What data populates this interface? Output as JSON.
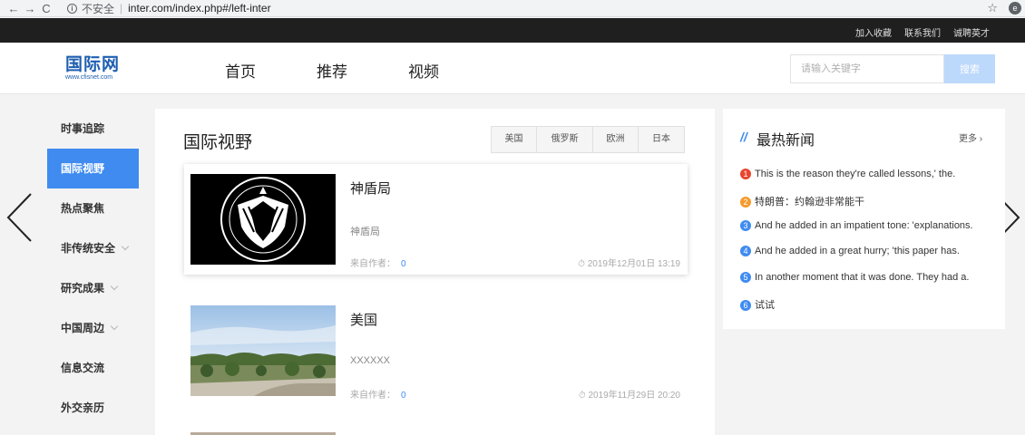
{
  "browser": {
    "back": "←",
    "forward": "→",
    "reload": "C",
    "security_label": "不安全",
    "url": "inter.com/index.php#/left-inter"
  },
  "topbar": {
    "links": [
      "加入收藏",
      "联系我们",
      "诚聘英才"
    ]
  },
  "header": {
    "logo_text": "国际网",
    "logo_sub": "www.cfisnet.com",
    "nav": [
      "首页",
      "推荐",
      "视频"
    ],
    "search_placeholder": "请输入关键字",
    "search_button": "搜索"
  },
  "sidebar": {
    "items": [
      {
        "label": "时事追踪",
        "active": false,
        "has_dropdown": false
      },
      {
        "label": "国际视野",
        "active": true,
        "has_dropdown": false
      },
      {
        "label": "热点聚焦",
        "active": false,
        "has_dropdown": false
      },
      {
        "label": "非传统安全",
        "active": false,
        "has_dropdown": true
      },
      {
        "label": "研究成果",
        "active": false,
        "has_dropdown": true
      },
      {
        "label": "中国周边",
        "active": false,
        "has_dropdown": true
      },
      {
        "label": "信息交流",
        "active": false,
        "has_dropdown": false
      },
      {
        "label": "外交亲历",
        "active": false,
        "has_dropdown": false
      }
    ]
  },
  "main": {
    "title": "国际视野",
    "tabs": [
      "美国",
      "俄罗斯",
      "欧洲",
      "日本"
    ],
    "articles": [
      {
        "title": "神盾局",
        "desc": "神盾局",
        "author_label": "来自作者：",
        "count": "0",
        "date": "⏱ 2019年12月01日 13:19"
      },
      {
        "title": "美国",
        "desc": "XXXXXX",
        "author_label": "来自作者：",
        "count": "0",
        "date": "⏱ 2019年11月29日 20:20"
      }
    ]
  },
  "hot": {
    "mark": "//",
    "title": "最热新闻",
    "more": "更多 ›",
    "items": [
      {
        "num": "1",
        "text": "This is the reason they're called lessons,' the.",
        "color": "#e8452f"
      },
      {
        "num": "2",
        "text": "特朗普：约翰逊非常能干",
        "color": "#f59a2c"
      },
      {
        "num": "3",
        "text": "And he added in an impatient tone: 'explanations.",
        "color": "#3f8bf0"
      },
      {
        "num": "4",
        "text": "And he added in a great hurry; 'this paper has.",
        "color": "#3f8bf0"
      },
      {
        "num": "5",
        "text": "In another moment that it was done. They had a.",
        "color": "#3f8bf0"
      },
      {
        "num": "6",
        "text": "试试",
        "color": "#3f8bf0"
      }
    ]
  },
  "colors": {
    "accent": "#3f8bf0",
    "topbar_bg": "#1f1f1f",
    "logo": "#1f5fb0"
  }
}
